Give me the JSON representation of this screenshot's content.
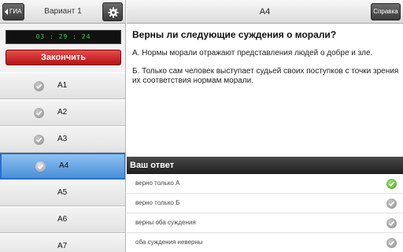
{
  "sidebar": {
    "back_label": "ГИА",
    "variant_title": "Вариант 1",
    "timer": "03 : 29 : 24",
    "finish_label": "Закончить",
    "items": [
      {
        "label": "А1"
      },
      {
        "label": "А2"
      },
      {
        "label": "А3"
      },
      {
        "label": "А4"
      },
      {
        "label": "А5"
      },
      {
        "label": "А6"
      },
      {
        "label": "А7"
      }
    ]
  },
  "main": {
    "title": "А4",
    "help_label": "Справка",
    "question": "Верны ли следующие суждения о морали?",
    "statement_a": "А. Нормы морали отражают представления людей о добре и зле.",
    "statement_b": "Б. Только сам человек выступает судьей своих поступков с точки зрения их соответствия нормам морали.",
    "answer_header": "Ваш ответ",
    "answers": [
      {
        "label": "верно только А"
      },
      {
        "label": "верно только Б"
      },
      {
        "label": "верны оба суждения"
      },
      {
        "label": "оба суждения неверны"
      }
    ]
  },
  "colors": {
    "selected_item": "#4a8fd8",
    "finish_button": "#c81e1e",
    "timer_text": "#27d43b",
    "answer_check_selected": "#47a422"
  }
}
